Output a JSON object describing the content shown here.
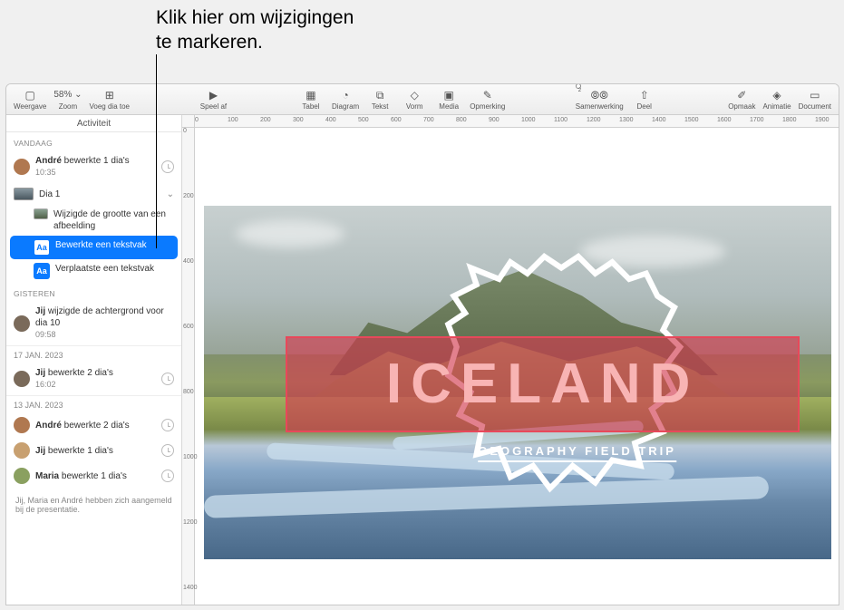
{
  "annotation": {
    "line1": "Klik hier om wijzigingen",
    "line2": "te markeren."
  },
  "toolbar": {
    "weergave": "Weergave",
    "zoom_value": "58% ⌄",
    "zoom": "Zoom",
    "voeg_dia": "Voeg dia toe",
    "speel_af": "Speel af",
    "tabel": "Tabel",
    "diagram": "Diagram",
    "tekst": "Tekst",
    "vorm": "Vorm",
    "media": "Media",
    "opmerking": "Opmerking",
    "samenwerking_count": "2",
    "samenwerking": "Samenwerking",
    "deel": "Deel",
    "opmaak": "Opmaak",
    "animatie": "Animatie",
    "document": "Document"
  },
  "sidebar": {
    "title": "Activiteit",
    "sections": {
      "vandaag": "VANDAAG",
      "gisteren": "GISTEREN"
    },
    "today_row1": {
      "name": "André",
      "text": " bewerkte 1 dia's",
      "time": "10:35"
    },
    "today_dia1": "Dia 1",
    "today_sub1": "Wijzigde de grootte van een afbeelding",
    "today_sub2": "Bewerkte een tekstvak",
    "today_sub3": "Verplaatste een tekstvak",
    "yesterday_row1": {
      "name": "Jij",
      "text": " wijzigde de achtergrond voor dia 10",
      "time": "09:58"
    },
    "date1": "17 JAN. 2023",
    "date1_row1": {
      "name": "Jij",
      "text": " bewerkte 2 dia's",
      "time": "16:02"
    },
    "date2": "13 JAN. 2023",
    "date2_row1": {
      "name": "André",
      "text": " bewerkte 2 dia's"
    },
    "date2_row2": {
      "name": "Jij",
      "text": " bewerkte 1 dia's"
    },
    "date2_row3": {
      "name": "Maria",
      "text": " bewerkte 1 dia's"
    },
    "footer": {
      "p1": "Jij",
      "p_sep1": ", ",
      "p2": "Maria",
      "p_sep2": " en ",
      "p3": "André",
      "rest": " hebben zich aangemeld bij de presentatie."
    }
  },
  "slide": {
    "title": "ICELAND",
    "subtitle": "GEOGRAPHY FIELD TRIP"
  },
  "ruler_h": [
    "0",
    "100",
    "200",
    "300",
    "400",
    "500",
    "600",
    "700",
    "800",
    "900",
    "1000",
    "1100",
    "1200",
    "1300",
    "1400",
    "1500",
    "1600",
    "1700",
    "1800",
    "1900"
  ],
  "ruler_v": [
    "0",
    "200",
    "400",
    "600",
    "800",
    "1000",
    "1200",
    "1400"
  ]
}
